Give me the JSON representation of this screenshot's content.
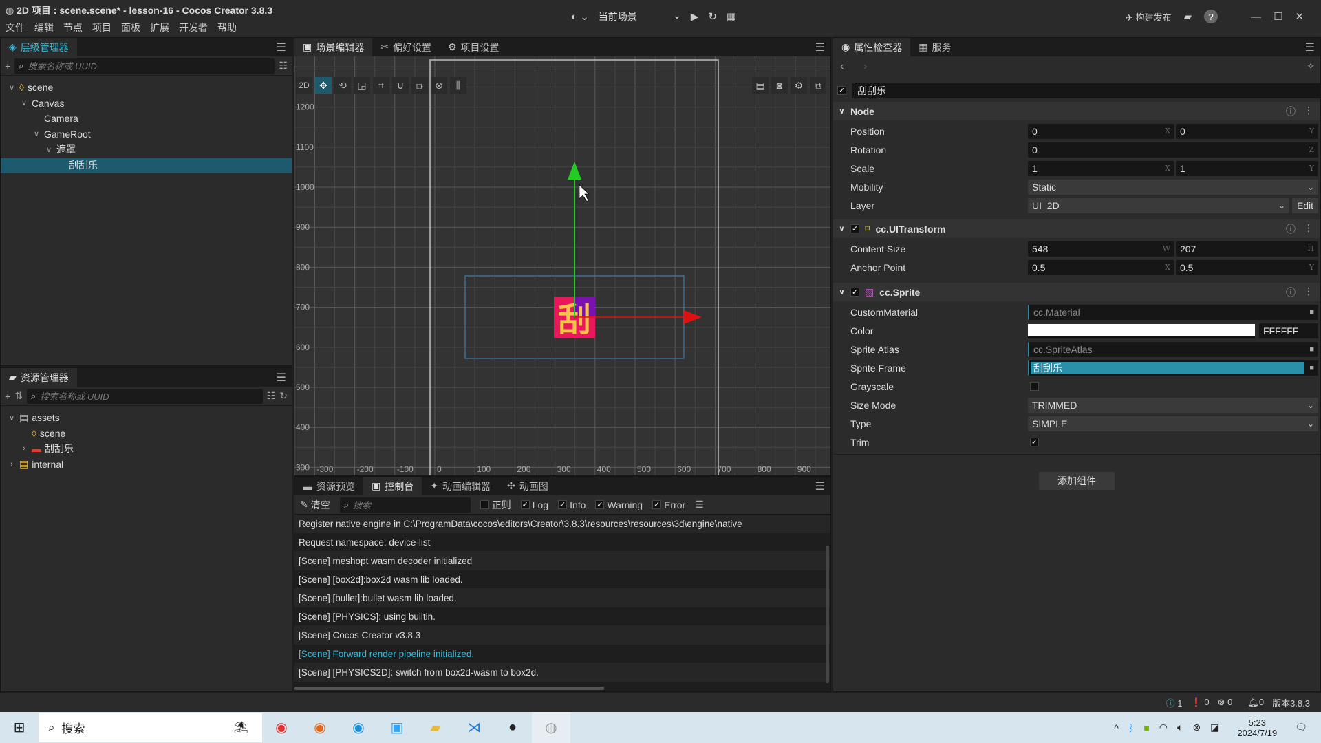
{
  "window": {
    "title": "2D 项目 : scene.scene* - lesson-16 - Cocos Creator 3.8.3",
    "menu": [
      "文件",
      "编辑",
      "节点",
      "项目",
      "面板",
      "扩展",
      "开发者",
      "帮助"
    ],
    "scene_select": "当前场景",
    "build_label": "构建发布"
  },
  "hierarchy": {
    "tab": "层级管理器",
    "search_placeholder": "搜索名称或 UUID",
    "items": [
      {
        "label": "scene",
        "depth": 0,
        "expanded": true,
        "icon": "scene-icon"
      },
      {
        "label": "Canvas",
        "depth": 1,
        "expanded": true
      },
      {
        "label": "Camera",
        "depth": 2
      },
      {
        "label": "GameRoot",
        "depth": 2,
        "expanded": true
      },
      {
        "label": "遮罩",
        "depth": 3,
        "expanded": true
      },
      {
        "label": "刮刮乐",
        "depth": 4,
        "selected": true
      }
    ]
  },
  "assets": {
    "tab": "资源管理器",
    "search_placeholder": "搜索名称或 UUID",
    "items": [
      {
        "label": "assets",
        "depth": 0,
        "expanded": true,
        "icon": "folder-icon"
      },
      {
        "label": "scene",
        "depth": 1,
        "icon": "scene-icon"
      },
      {
        "label": "刮刮乐",
        "depth": 1,
        "collapsed": true,
        "icon": "image-icon"
      },
      {
        "label": "internal",
        "depth": 0,
        "collapsed": true,
        "icon": "folder-icon"
      }
    ]
  },
  "scene": {
    "tabs": [
      "场景编辑器",
      "偏好设置",
      "项目设置"
    ],
    "mode_2d": "2D",
    "x_ticks": [
      "-300",
      "-200",
      "-100",
      "0",
      "100",
      "200",
      "300",
      "400",
      "500",
      "600",
      "700",
      "800",
      "900"
    ],
    "y_ticks": [
      "1200",
      "1100",
      "1000",
      "900",
      "800",
      "700",
      "600",
      "500",
      "400",
      "300"
    ],
    "sprite_glyph": "刮",
    "colors": {
      "y_axis": "#22cc22",
      "x_axis": "#dd1111",
      "selection": "#3b6f91",
      "sprite": "#e8185a"
    }
  },
  "console": {
    "tabs": [
      "资源预览",
      "控制台",
      "动画编辑器",
      "动画图"
    ],
    "clear": "清空",
    "search_placeholder": "搜索",
    "filters": [
      {
        "label": "正则",
        "checked": false
      },
      {
        "label": "Log",
        "checked": true
      },
      {
        "label": "Info",
        "checked": true
      },
      {
        "label": "Warning",
        "checked": true
      },
      {
        "label": "Error",
        "checked": true
      }
    ],
    "logs": [
      {
        "text": "Register native engine in C:\\ProgramData\\cocos\\editors\\Creator\\3.8.3\\resources\\resources\\3d\\engine\\native"
      },
      {
        "text": "Request namespace: device-list"
      },
      {
        "text": "[Scene] meshopt wasm decoder initialized"
      },
      {
        "text": "[Scene] [box2d]:box2d wasm lib loaded."
      },
      {
        "text": "[Scene] [bullet]:bullet wasm lib loaded."
      },
      {
        "text": "[Scene] [PHYSICS]: using builtin."
      },
      {
        "text": "[Scene] Cocos Creator v3.8.3"
      },
      {
        "text": "[Scene] Forward render pipeline initialized.",
        "level": "info"
      },
      {
        "text": "[Scene] [PHYSICS2D]: switch from box2d-wasm to box2d."
      }
    ]
  },
  "inspector": {
    "tabs": [
      "属性检查器",
      "服务"
    ],
    "node_name": "刮刮乐",
    "node": {
      "title": "Node",
      "position": {
        "label": "Position",
        "x": "0",
        "y": "0"
      },
      "rotation": {
        "label": "Rotation",
        "z": "0"
      },
      "scale": {
        "label": "Scale",
        "x": "1",
        "y": "1"
      },
      "mobility": {
        "label": "Mobility",
        "value": "Static"
      },
      "layer": {
        "label": "Layer",
        "value": "UI_2D",
        "edit": "Edit"
      }
    },
    "uitransform": {
      "title": "cc.UITransform",
      "content_size": {
        "label": "Content Size",
        "w": "548",
        "h": "207"
      },
      "anchor": {
        "label": "Anchor Point",
        "x": "0.5",
        "y": "0.5"
      }
    },
    "sprite": {
      "title": "cc.Sprite",
      "custom_material": {
        "label": "CustomMaterial",
        "value": "cc.Material"
      },
      "color": {
        "label": "Color",
        "value": "FFFFFF"
      },
      "atlas": {
        "label": "Sprite Atlas",
        "value": "cc.SpriteAtlas"
      },
      "frame": {
        "label": "Sprite Frame",
        "value": "刮刮乐"
      },
      "grayscale": {
        "label": "Grayscale",
        "checked": false
      },
      "size_mode": {
        "label": "Size Mode",
        "value": "TRIMMED"
      },
      "type": {
        "label": "Type",
        "value": "SIMPLE"
      },
      "trim": {
        "label": "Trim",
        "checked": true
      }
    },
    "add_component": "添加组件"
  },
  "status": {
    "info": "1",
    "warn": "0",
    "error": "0",
    "notify": "0",
    "version": "版本3.8.3"
  },
  "taskbar": {
    "search": "搜索",
    "time": "5:23",
    "date": "2024/7/19"
  }
}
